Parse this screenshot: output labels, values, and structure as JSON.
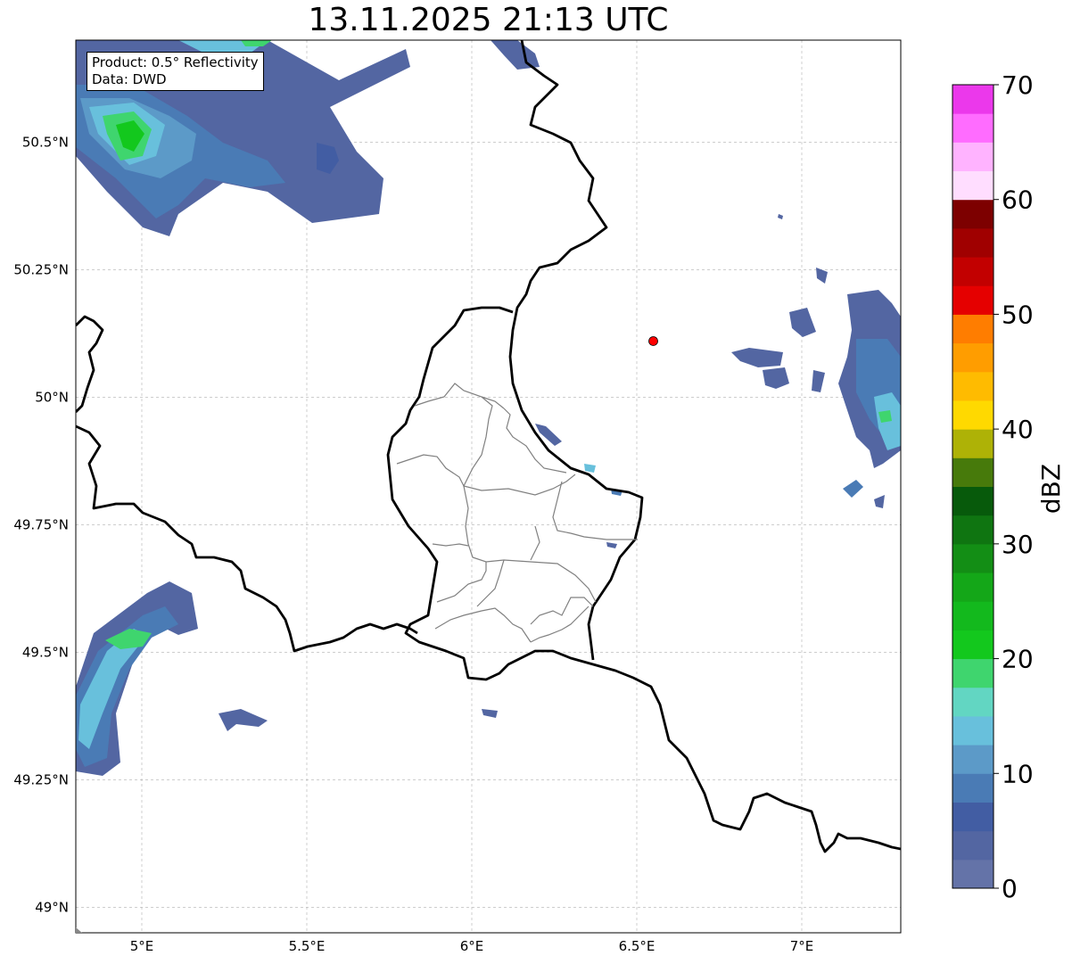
{
  "title": "13.11.2025 21:13 UTC",
  "info_box": {
    "product": "Product: 0.5° Reflectivity",
    "data": "Data: DWD"
  },
  "map": {
    "lon_range": [
      4.8,
      7.3
    ],
    "lat_range": [
      48.95,
      50.7
    ],
    "lon_ticks": [
      {
        "value": 5.0,
        "label": "5°E"
      },
      {
        "value": 5.5,
        "label": "5.5°E"
      },
      {
        "value": 6.0,
        "label": "6°E"
      },
      {
        "value": 6.5,
        "label": "6.5°E"
      },
      {
        "value": 7.0,
        "label": "7°E"
      }
    ],
    "lat_ticks": [
      {
        "value": 50.5,
        "label": "50.5°N"
      },
      {
        "value": 50.25,
        "label": "50.25°N"
      },
      {
        "value": 50.0,
        "label": "50°N"
      },
      {
        "value": 49.75,
        "label": "49.75°N"
      },
      {
        "value": 49.5,
        "label": "49.5°N"
      },
      {
        "value": 49.25,
        "label": "49.25°N"
      },
      {
        "value": 49.0,
        "label": "49°N"
      }
    ],
    "radar_site": {
      "lon": 6.55,
      "lat": 50.11,
      "color": "#ff0000"
    },
    "border_color": "#000000",
    "canton_color": "#808080"
  },
  "colorbar": {
    "label": "dBZ",
    "min": 0,
    "max": 70,
    "ticks": [
      0,
      10,
      20,
      30,
      40,
      50,
      60,
      70
    ],
    "colors": [
      "#6473a8",
      "#5366a2",
      "#425da3",
      "#4a7bb5",
      "#5c9ac8",
      "#68c0dc",
      "#62d6c2",
      "#3fd56e",
      "#13c81d",
      "#13b91d",
      "#14a718",
      "#138e15",
      "#0f7511",
      "#075a0b",
      "#477a0b",
      "#aeb206",
      "#ffd900",
      "#ffbb00",
      "#ff9d00",
      "#ff7d00",
      "#e50000",
      "#c20000",
      "#a00000",
      "#7d0000",
      "#ffddff",
      "#ffb3ff",
      "#ff6cff",
      "#eb38eb"
    ]
  }
}
